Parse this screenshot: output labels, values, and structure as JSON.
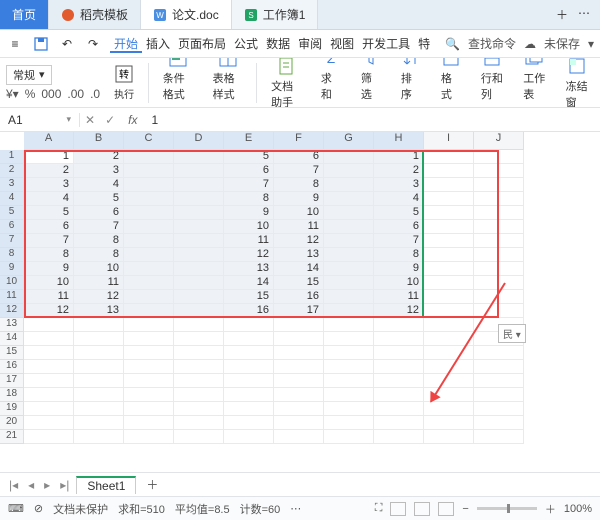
{
  "tabs": {
    "home": "首页",
    "daoke": "稻壳模板",
    "doc": "论文.doc",
    "sheet": "工作簿1"
  },
  "ribbon": {
    "file_icon": "≡",
    "items": [
      "开始",
      "插入",
      "页面布局",
      "公式",
      "数据",
      "审阅",
      "视图",
      "开发工具",
      "特"
    ],
    "search": "查找命令",
    "unsaved": "未保存"
  },
  "toolbar": {
    "exec": "执行",
    "numfmt": "常规",
    "pct": "%",
    "comma": "000",
    "inc": ".00",
    "dec": ".0",
    "condfmt": "条件格式",
    "tablestyle": "表格样式",
    "dochelper": "文档助手",
    "sum": "求和",
    "filter": "筛选",
    "sort": "排序",
    "format": "格式",
    "rowcol": "行和列",
    "worksheet": "工作表",
    "freeze": "冻结窗"
  },
  "namebox": "A1",
  "formula": "1",
  "columns": [
    "A",
    "B",
    "C",
    "D",
    "E",
    "F",
    "G",
    "H",
    "I",
    "J"
  ],
  "rownums": [
    1,
    2,
    3,
    4,
    5,
    6,
    7,
    8,
    9,
    10,
    11,
    12,
    13,
    14,
    15,
    16,
    17,
    18,
    19,
    20,
    21
  ],
  "data": [
    [
      1,
      2,
      "",
      "",
      5,
      6,
      "",
      1
    ],
    [
      2,
      3,
      "",
      "",
      6,
      7,
      "",
      2
    ],
    [
      3,
      4,
      "",
      "",
      7,
      8,
      "",
      3
    ],
    [
      4,
      5,
      "",
      "",
      8,
      9,
      "",
      4
    ],
    [
      5,
      6,
      "",
      "",
      9,
      10,
      "",
      5
    ],
    [
      6,
      7,
      "",
      "",
      10,
      11,
      "",
      6
    ],
    [
      7,
      8,
      "",
      "",
      11,
      12,
      "",
      7
    ],
    [
      8,
      8,
      "",
      "",
      12,
      13,
      "",
      8
    ],
    [
      9,
      10,
      "",
      "",
      13,
      14,
      "",
      9
    ],
    [
      10,
      11,
      "",
      "",
      14,
      15,
      "",
      10
    ],
    [
      11,
      12,
      "",
      "",
      15,
      16,
      "",
      11
    ],
    [
      12,
      13,
      "",
      "",
      16,
      17,
      "",
      12
    ]
  ],
  "smarttag": "民",
  "sheets": {
    "active": "Sheet1"
  },
  "status": {
    "protect": "文档未保护",
    "sum": "求和=510",
    "avg": "平均值=8.5",
    "count": "计数=60",
    "zoom": "100%"
  }
}
